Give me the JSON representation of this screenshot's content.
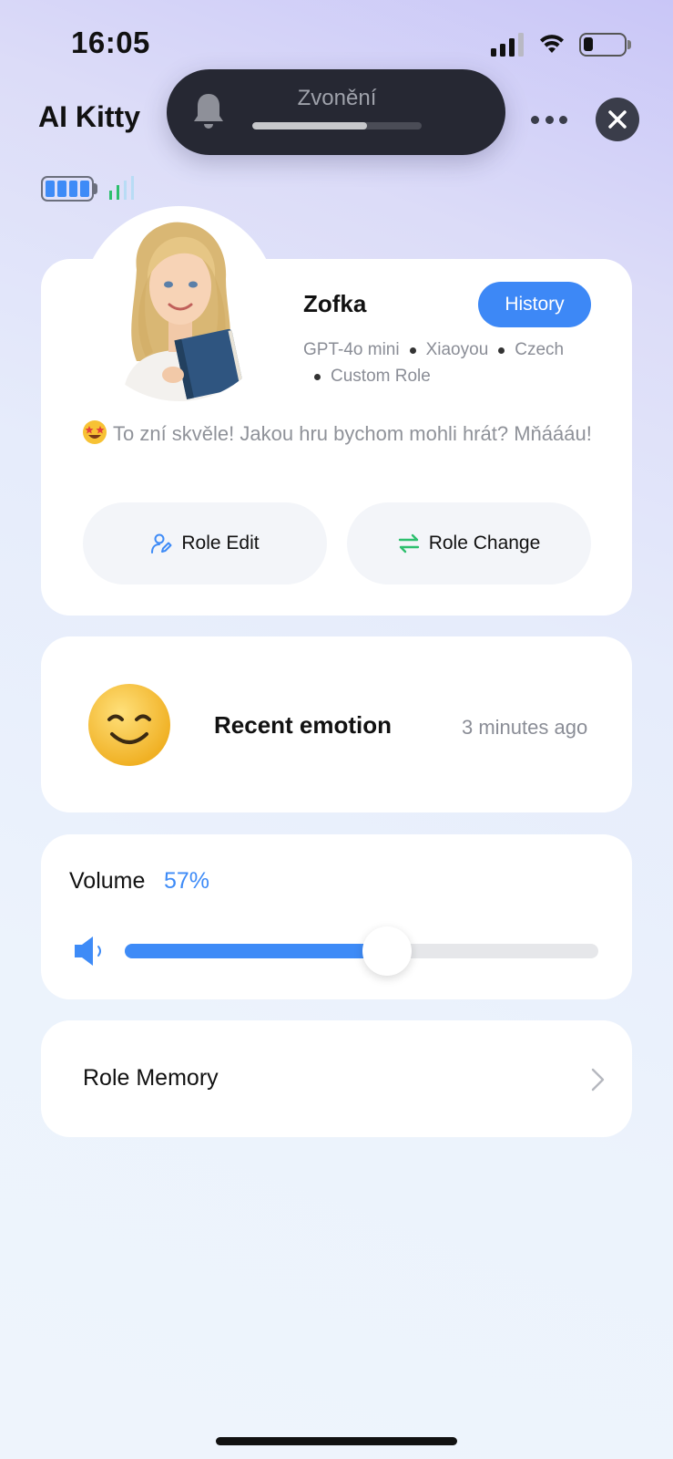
{
  "status_bar": {
    "time": "16:05",
    "battery_level": 0.2
  },
  "header": {
    "title": "AI Kitty"
  },
  "ringer": {
    "label": "Zvonění",
    "level": 0.68
  },
  "device": {
    "battery_level": 1.0
  },
  "role": {
    "name": "Zofka",
    "history_label": "History",
    "meta": [
      "GPT-4o mini",
      "Xiaoyou",
      "Czech",
      "Custom Role"
    ],
    "message": "To zní skvěle! Jakou hru bychom mohli hrát? Mňáááu!",
    "edit_label": "Role Edit",
    "change_label": "Role Change"
  },
  "emotion": {
    "title": "Recent emotion",
    "time": "3 minutes ago"
  },
  "volume": {
    "label": "Volume",
    "value_text": "57%",
    "value": 57
  },
  "memory": {
    "label": "Role Memory"
  },
  "colors": {
    "accent": "#3e8bf7",
    "dark": "#3a3d4a",
    "green": "#2dbf6e"
  }
}
